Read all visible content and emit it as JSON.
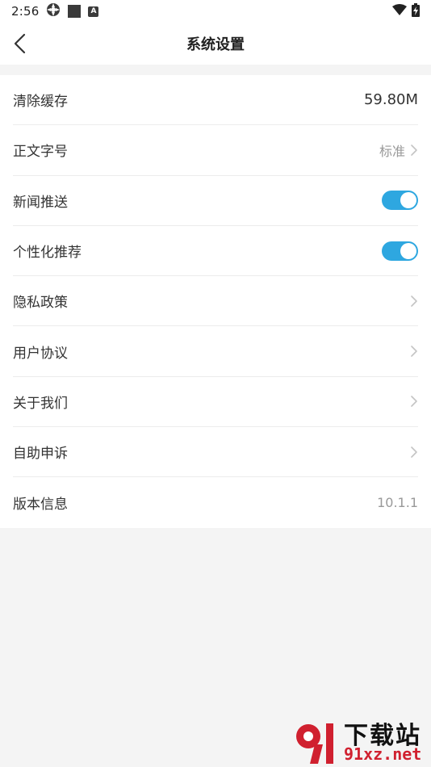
{
  "status_bar": {
    "time": "2:56",
    "icons": [
      "settings-wheel-icon",
      "square-icon",
      "a-badge-icon",
      "wifi-icon",
      "battery-charging-icon"
    ],
    "a_badge": "A"
  },
  "nav": {
    "title": "系统设置",
    "back_icon": "chevron-left-icon"
  },
  "settings": {
    "items": [
      {
        "label": "清除缓存",
        "value": "59.80M",
        "type": "value"
      },
      {
        "label": "正文字号",
        "value": "标准",
        "type": "link-value"
      },
      {
        "label": "新闻推送",
        "type": "toggle",
        "on": true
      },
      {
        "label": "个性化推荐",
        "type": "toggle",
        "on": true
      },
      {
        "label": "隐私政策",
        "type": "link"
      },
      {
        "label": "用户协议",
        "type": "link"
      },
      {
        "label": "关于我们",
        "type": "link"
      },
      {
        "label": "自助申诉",
        "type": "link"
      },
      {
        "label": "版本信息",
        "value": "10.1.1",
        "type": "value-muted"
      }
    ]
  },
  "watermark": {
    "title": "下载站",
    "url": "91xz.net"
  },
  "colors": {
    "accent": "#2ea7e0",
    "chevron": "#c4c4c4",
    "watermark_red": "#d0202f"
  }
}
